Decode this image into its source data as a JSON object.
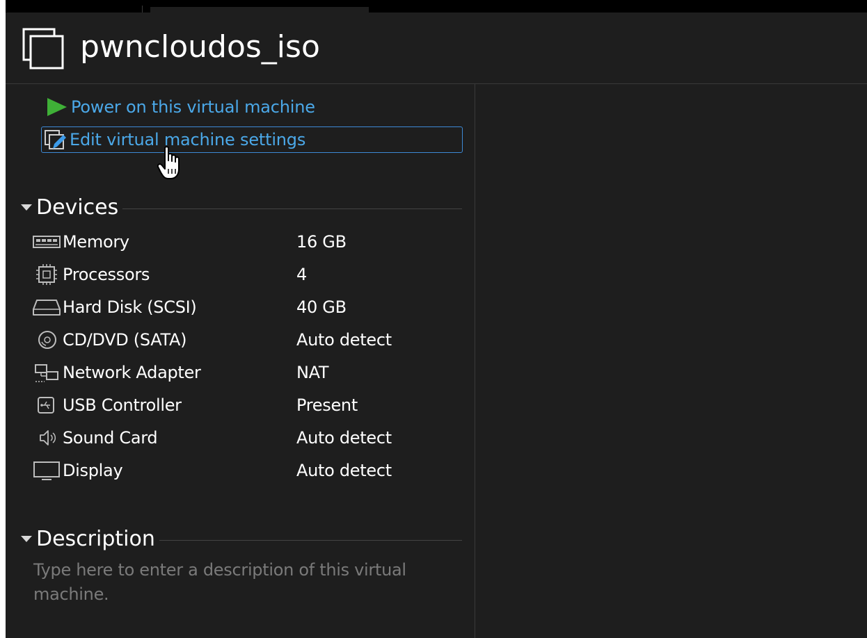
{
  "vm": {
    "name": "pwncloudos_iso"
  },
  "commands": {
    "power_on": "Power on this virtual machine",
    "edit_settings": "Edit virtual machine settings"
  },
  "devices": {
    "heading": "Devices",
    "items": [
      {
        "icon": "memory-icon",
        "name": "Memory",
        "value": "16 GB"
      },
      {
        "icon": "processor-icon",
        "name": "Processors",
        "value": "4"
      },
      {
        "icon": "hard-disk-icon",
        "name": "Hard Disk (SCSI)",
        "value": "40 GB"
      },
      {
        "icon": "cd-dvd-icon",
        "name": "CD/DVD (SATA)",
        "value": "Auto detect"
      },
      {
        "icon": "network-adapter-icon",
        "name": "Network Adapter",
        "value": "NAT"
      },
      {
        "icon": "usb-icon",
        "name": "USB Controller",
        "value": "Present"
      },
      {
        "icon": "sound-card-icon",
        "name": "Sound Card",
        "value": "Auto detect"
      },
      {
        "icon": "display-icon",
        "name": "Display",
        "value": "Auto detect"
      }
    ]
  },
  "description": {
    "heading": "Description",
    "placeholder": "Type here to enter a description of this virtual machine."
  },
  "colors": {
    "background": "#1e1e1e",
    "link": "#4ba8e8",
    "play_green": "#3fb037",
    "focus_border": "#3d8ad6"
  }
}
